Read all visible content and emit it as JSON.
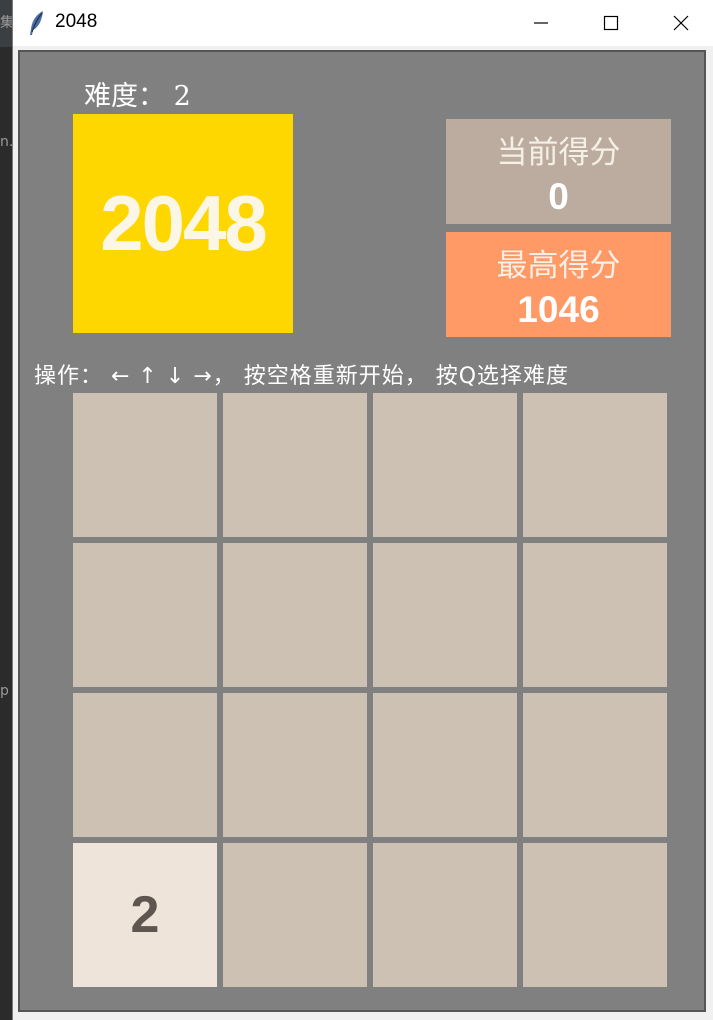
{
  "window": {
    "title": "2048"
  },
  "background_fragments": [
    "集",
    "n.",
    "p"
  ],
  "game": {
    "difficulty_text": "难度： 2",
    "logo_text": "2048",
    "current_score_label": "当前得分",
    "current_score": "0",
    "best_score_label": "最高得分",
    "best_score": "1046",
    "instructions": "操作： ←  ↑  ↓  →， 按空格重新开始， 按Q选择难度"
  },
  "board": {
    "rows": [
      [
        "",
        "",
        "",
        ""
      ],
      [
        "",
        "",
        "",
        ""
      ],
      [
        "",
        "",
        "",
        ""
      ],
      [
        "2",
        "",
        "",
        ""
      ]
    ]
  },
  "colors": {
    "board_bg": "#808080",
    "empty_tile": "#cdc1b4",
    "tile_2": "#eee4da",
    "logo_bg": "#ffd700",
    "current_score_bg": "#bbac9f",
    "best_score_bg": "#ff9966"
  },
  "icons": {
    "app_icon": "feather-icon",
    "minimize": "minimize-icon",
    "maximize": "maximize-icon",
    "close": "close-icon"
  }
}
